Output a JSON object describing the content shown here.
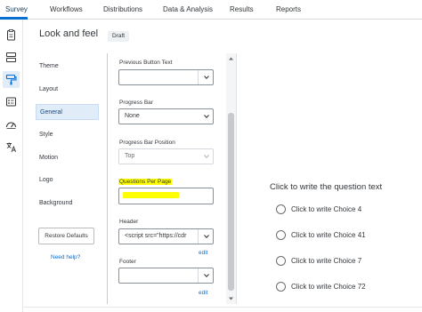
{
  "nav": {
    "tabs": [
      {
        "label": "Survey"
      },
      {
        "label": "Workflows"
      },
      {
        "label": "Distributions"
      },
      {
        "label": "Data & Analysis"
      },
      {
        "label": "Results"
      },
      {
        "label": "Reports"
      }
    ],
    "active_tab": "Survey"
  },
  "leftbar": {
    "icons": [
      "survey-flow-icon",
      "blocks-icon",
      "look-and-feel-icon",
      "options-icon",
      "tools-icon",
      "translate-icon"
    ],
    "active_icon": "look-and-feel-icon"
  },
  "header": {
    "title": "Look and feel",
    "badge": "Draft"
  },
  "menu": {
    "items": [
      {
        "label": "Theme"
      },
      {
        "label": "Layout"
      },
      {
        "label": "General"
      },
      {
        "label": "Style"
      },
      {
        "label": "Motion"
      },
      {
        "label": "Logo"
      },
      {
        "label": "Background"
      }
    ],
    "active": "General",
    "restore_label": "Restore Defaults",
    "help_label": "Need help?"
  },
  "settings": {
    "previous_button_text": {
      "label": "Previous Button Text",
      "value": ""
    },
    "progress_bar": {
      "label": "Progress Bar",
      "value": "None"
    },
    "progress_bar_position": {
      "label": "Progress Bar Position",
      "value": "Top"
    },
    "questions_per_page": {
      "label": "Questions Per Page",
      "value": ""
    },
    "header": {
      "label": "Header",
      "value": "<script src=\"https://cdr",
      "edit": "edit"
    },
    "footer": {
      "label": "Footer",
      "value": "",
      "edit": "edit"
    }
  },
  "preview": {
    "question": "Click to write the question text",
    "choices": [
      {
        "label": "Click to write Choice 4"
      },
      {
        "label": "Click to write Choice 41"
      },
      {
        "label": "Click to write Choice 7"
      },
      {
        "label": "Click to write Choice 72"
      }
    ]
  },
  "colors": {
    "accent": "#0a6ed1",
    "highlight": "#ffff00",
    "active_bg": "#e1ecf9"
  }
}
